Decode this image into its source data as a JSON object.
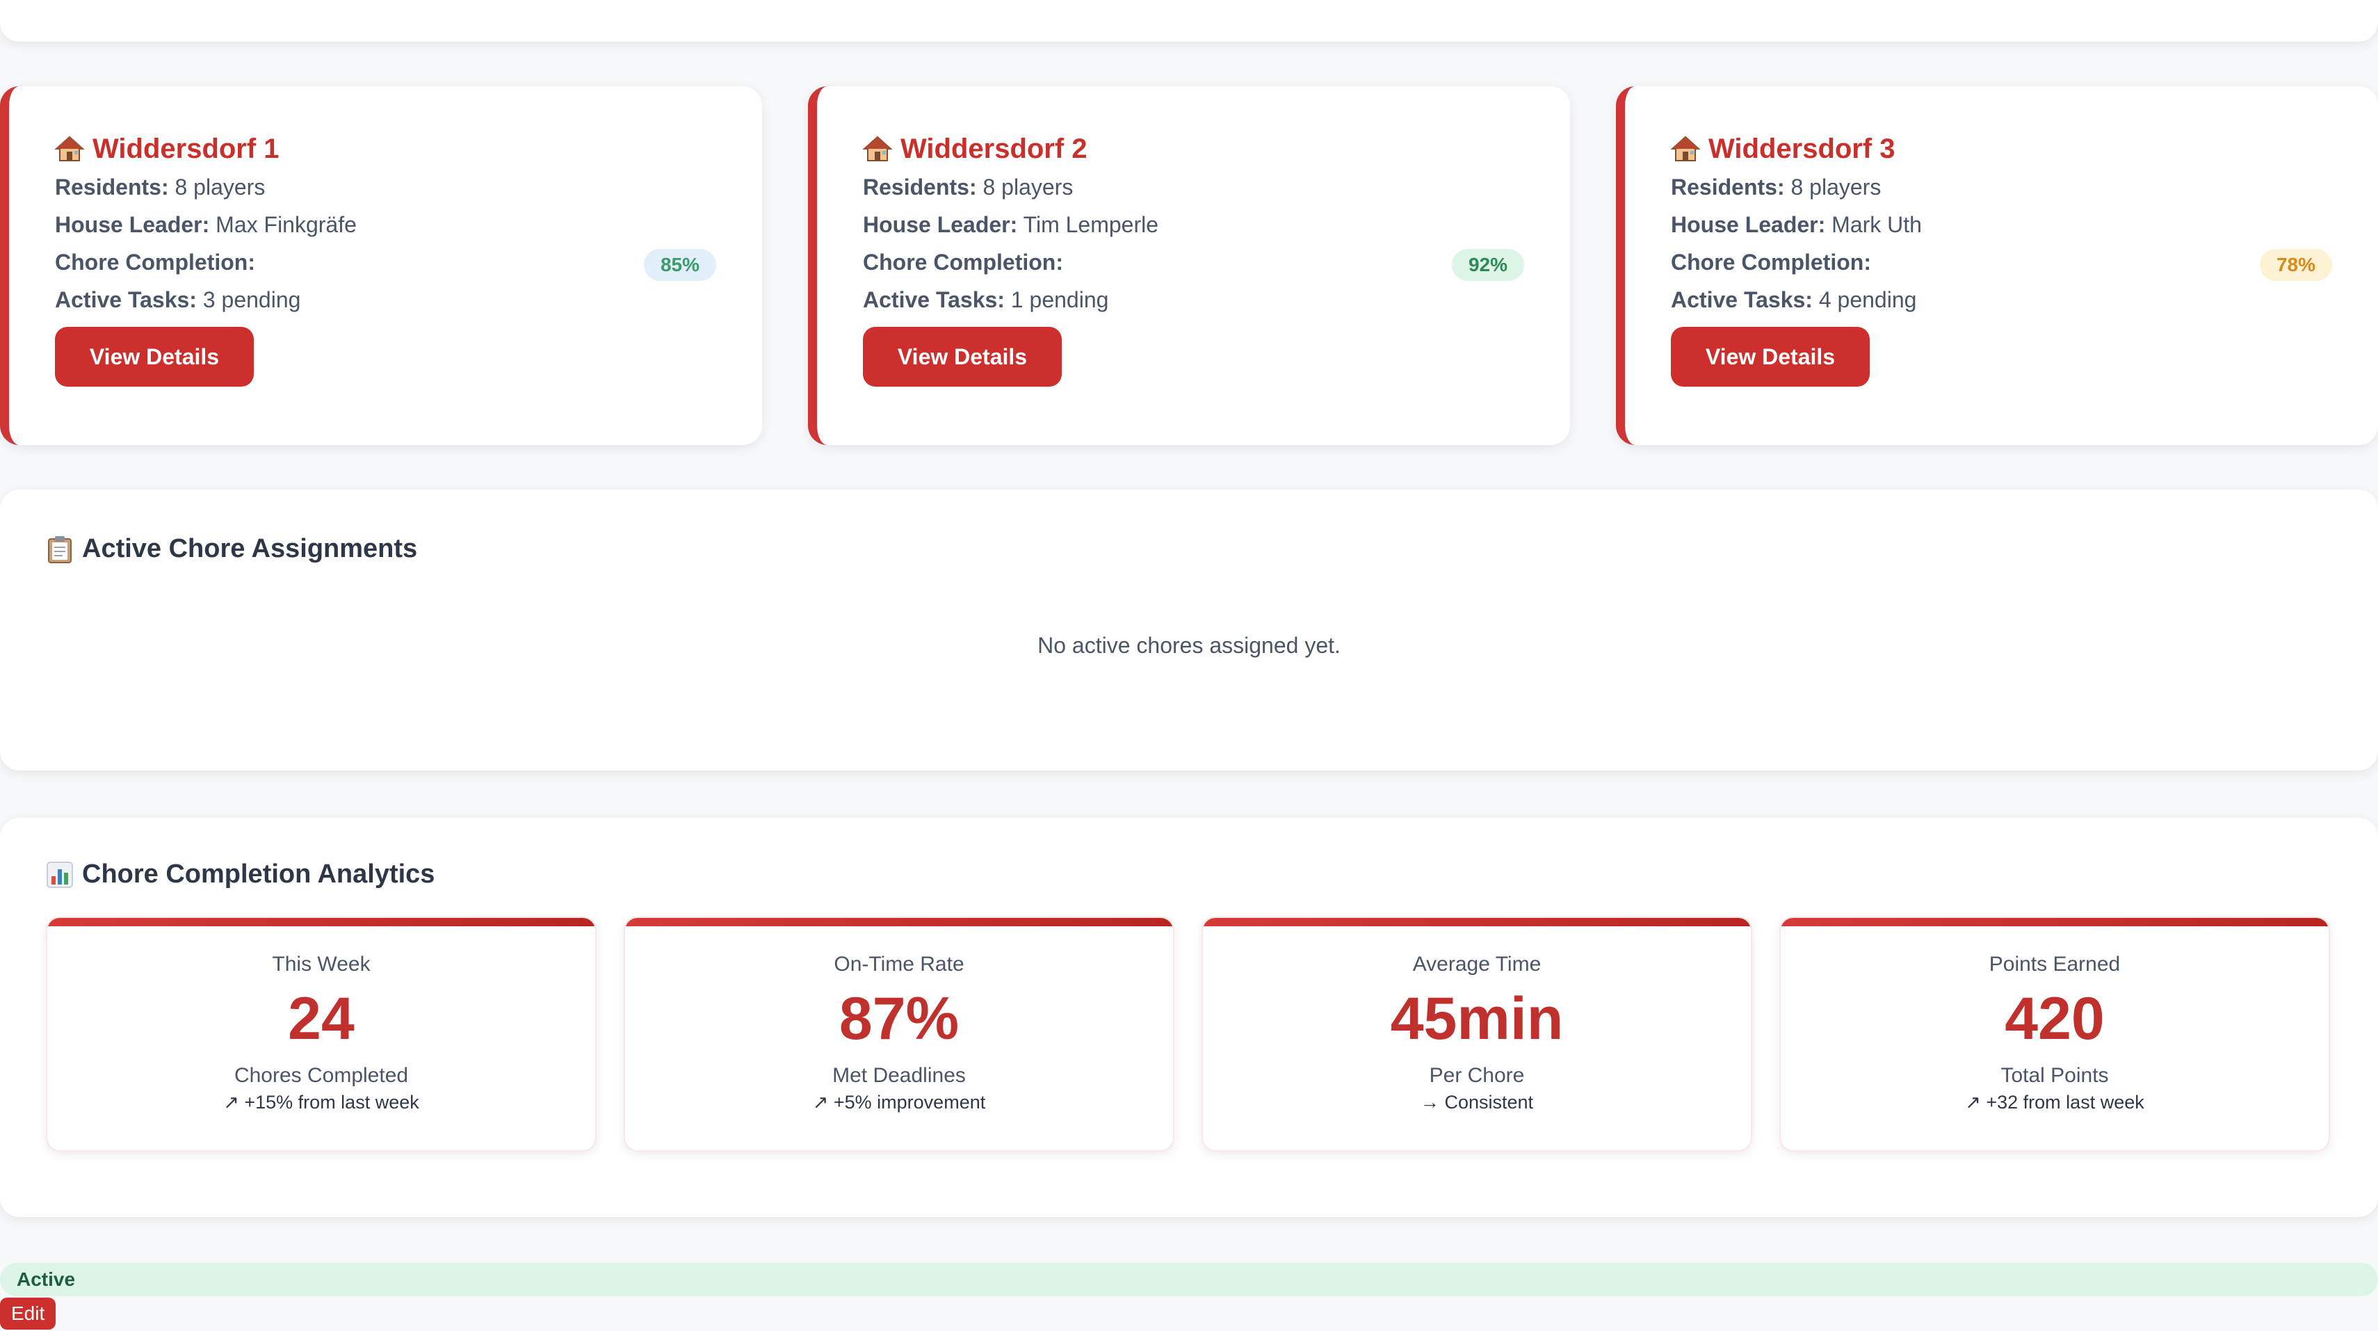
{
  "houses": [
    {
      "name": "Widdersdorf 1",
      "residents_label": "Residents:",
      "residents": "8 players",
      "leader_label": "House Leader:",
      "leader": "Max Finkgräfe",
      "completion_label": "Chore Completion:",
      "completion": "85%",
      "completion_color": "#3d9a6b",
      "completion_bg": "#e2eefa",
      "tasks_label": "Active Tasks:",
      "tasks": "3 pending",
      "button": "View Details"
    },
    {
      "name": "Widdersdorf 2",
      "residents_label": "Residents:",
      "residents": "8 players",
      "leader_label": "House Leader:",
      "leader": "Tim Lemperle",
      "completion_label": "Chore Completion:",
      "completion": "92%",
      "completion_color": "#2f8a56",
      "completion_bg": "#dcf5e6",
      "tasks_label": "Active Tasks:",
      "tasks": "1 pending",
      "button": "View Details"
    },
    {
      "name": "Widdersdorf 3",
      "residents_label": "Residents:",
      "residents": "8 players",
      "leader_label": "House Leader:",
      "leader": "Mark Uth",
      "completion_label": "Chore Completion:",
      "completion": "78%",
      "completion_color": "#d88a1c",
      "completion_bg": "#fdf3d4",
      "tasks_label": "Active Tasks:",
      "tasks": "4 pending",
      "button": "View Details"
    }
  ],
  "assignments": {
    "title": "Active Chore Assignments",
    "icon": "clipboard-icon",
    "empty": "No active chores assigned yet."
  },
  "analytics": {
    "title": "Chore Completion Analytics",
    "icon": "bar-chart-icon",
    "stats": [
      {
        "label": "This Week",
        "value": "24",
        "desc": "Chores Completed",
        "trend": "↗ +15% from last week"
      },
      {
        "label": "On-Time Rate",
        "value": "87%",
        "desc": "Met Deadlines",
        "trend": "↗ +5% improvement"
      },
      {
        "label": "Average Time",
        "value": "45min",
        "desc": "Per Chore",
        "trend": "→ Consistent"
      },
      {
        "label": "Points Earned",
        "value": "420",
        "desc": "Total Points",
        "trend": "↗ +32 from last week"
      }
    ]
  },
  "status": {
    "label": "Active"
  },
  "edit": {
    "label": "Edit"
  },
  "colors": {
    "accent": "#cc2f2c",
    "brand_red": "#c9302c"
  }
}
